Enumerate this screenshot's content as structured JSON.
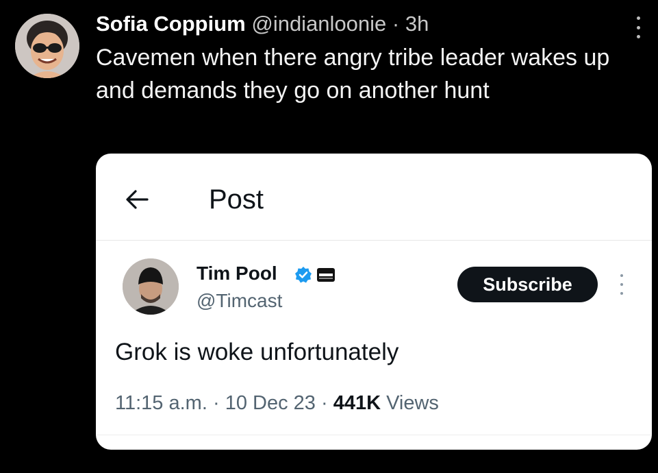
{
  "outer_tweet": {
    "display_name": "Sofia Coppium",
    "handle": "@indianloonie",
    "separator": "·",
    "time": "3h",
    "text": "Cavemen when there angry tribe leader wakes up and demands they go on another hunt",
    "avatar_icon": "cartoon-avatar-with-sunglasses",
    "more_icon": "vertical-ellipsis"
  },
  "embedded_post": {
    "header_title": "Post",
    "back_icon": "arrow-left",
    "author": {
      "name": "Tim Pool",
      "handle": "@Timcast",
      "verified_icon": "blue-verified-badge",
      "affiliate_icon": "affiliate-badge",
      "avatar_icon": "photo-avatar-beanie"
    },
    "subscribe_label": "Subscribe",
    "body": "Grok is woke unfortunately",
    "meta": {
      "time": "11:15 a.m.",
      "sep1": "·",
      "date": "10 Dec 23",
      "sep2": "·",
      "views_count": "441K",
      "views_label": "Views"
    }
  },
  "colors": {
    "background": "#000000",
    "card_background": "#ffffff",
    "verified_blue": "#1d9bf0",
    "secondary_text": "#536471",
    "subscribe_button": "#0f1419"
  }
}
